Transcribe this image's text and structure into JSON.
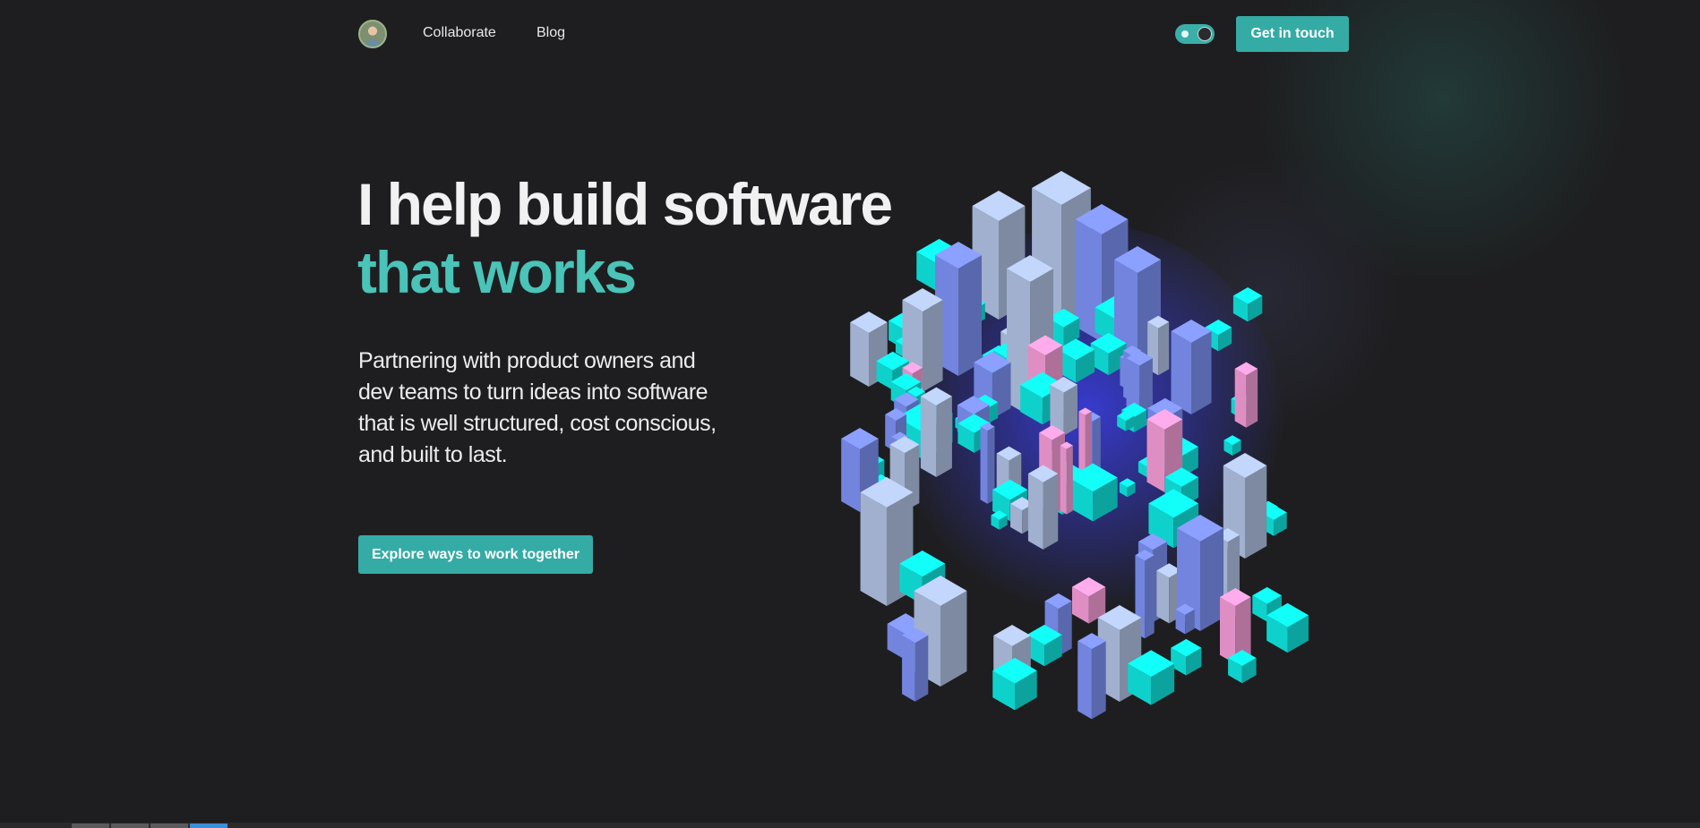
{
  "nav": {
    "avatar_icon": "avatar",
    "links": [
      "Collaborate",
      "Blog"
    ],
    "cta": "Get in touch"
  },
  "hero": {
    "headline_line1": "I help build software",
    "headline_line2": "that works",
    "subheadline": "Partnering with product owners and dev teams to turn ideas into software that is well structured, cost conscious, and built to last.",
    "cta": "Explore ways to work together"
  },
  "colors": {
    "accent": "#35aba5",
    "headline_accent": "#4ac3b8",
    "background": "#1e1e20",
    "cube_cyan": "#10e3dd",
    "cube_pink": "#f29ad4",
    "cube_blue": "#7c8ff0",
    "cube_grey": "#aebfe0"
  },
  "theme_toggle": {
    "icon": "theme-toggle-icon"
  },
  "illustration": {
    "icon": "isometric-cubes-illustration"
  }
}
